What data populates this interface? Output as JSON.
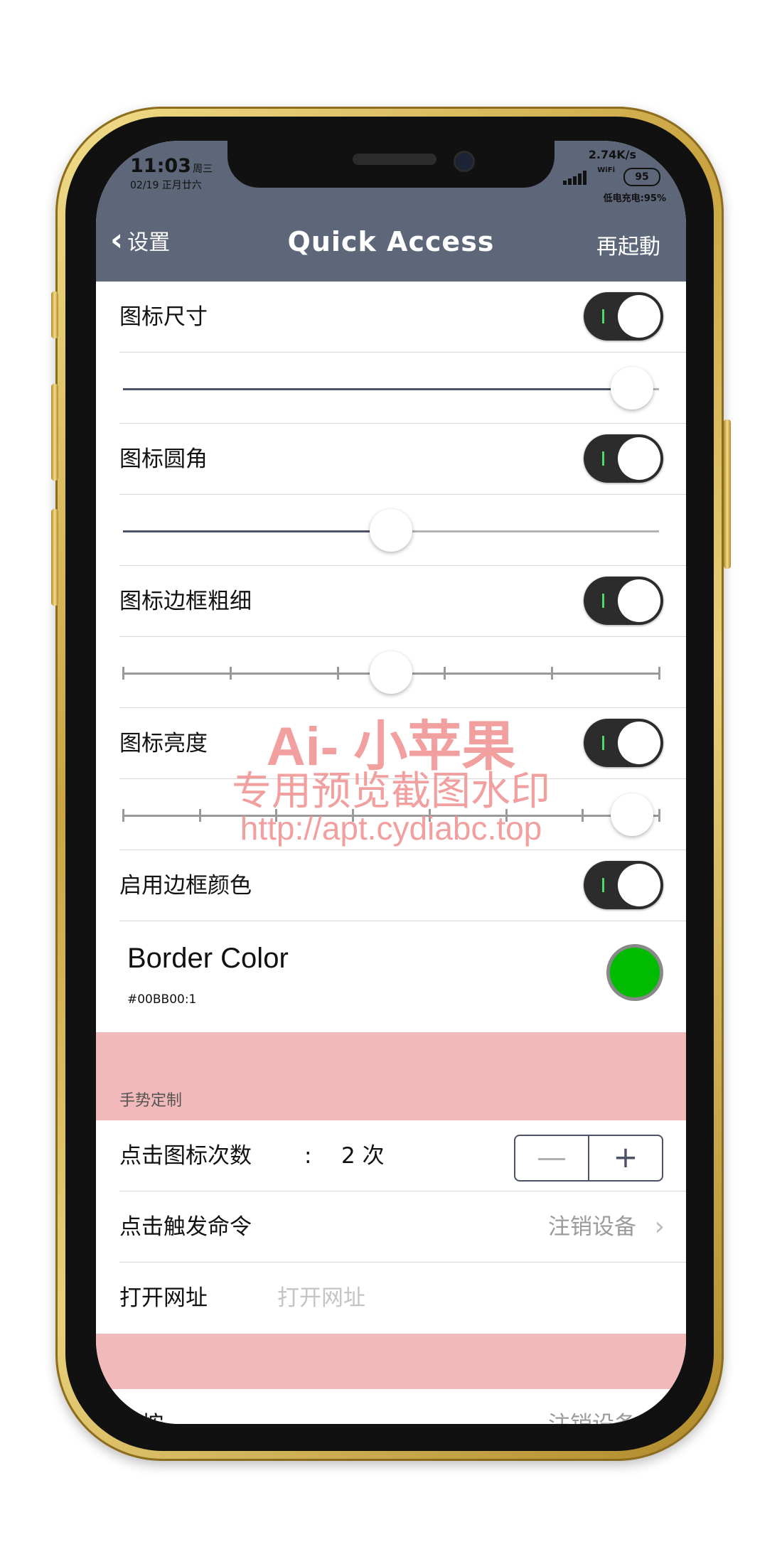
{
  "status": {
    "time": "11:03",
    "weekday": "周三",
    "date": "02/19 正月廿六",
    "speed": "2.74K/s",
    "wifi": "WiFi",
    "battery": "95",
    "battery_note": "低电充电:95%"
  },
  "nav": {
    "back_label": "设置",
    "title": "Quick Access",
    "right_label": "再起動"
  },
  "rows": {
    "icon_size": {
      "label": "图标尺寸",
      "toggle_on": true,
      "slider_value": 0.95
    },
    "icon_radius": {
      "label": "图标圆角",
      "toggle_on": true,
      "slider_value": 0.5
    },
    "border_width": {
      "label": "图标边框粗细",
      "toggle_on": true,
      "slider_value": 0.5,
      "ticks": 6
    },
    "brightness": {
      "label": "图标亮度",
      "toggle_on": true,
      "slider_value": 0.95,
      "ticks": 8
    },
    "border_color_enable": {
      "label": "启用边框颜色",
      "toggle_on": true
    }
  },
  "border_color": {
    "title": "Border Color",
    "value": "#00BB00:1",
    "swatch": "#00bb00"
  },
  "gesture": {
    "section_title": "手势定制",
    "tap_count_label": "点击图标次数",
    "tap_count_sep": ":",
    "tap_count_value": "2 次",
    "minus": "—",
    "plus": "+",
    "tap_command_label": "点击触发命令",
    "tap_command_value": "注销设备",
    "open_url_label": "打开网址",
    "open_url_placeholder": "打开网址",
    "long_press_label": "长按",
    "long_press_value": "注销设备"
  },
  "watermark": {
    "line1": "Ai- 小苹果",
    "line2": "专用预览截图水印",
    "line3": "http://apt.cydiabc.top"
  },
  "colors": {
    "nav_bg": "#5e6679",
    "section_bg": "#f1b9b9",
    "toggle_bg": "#2c2c2c"
  }
}
